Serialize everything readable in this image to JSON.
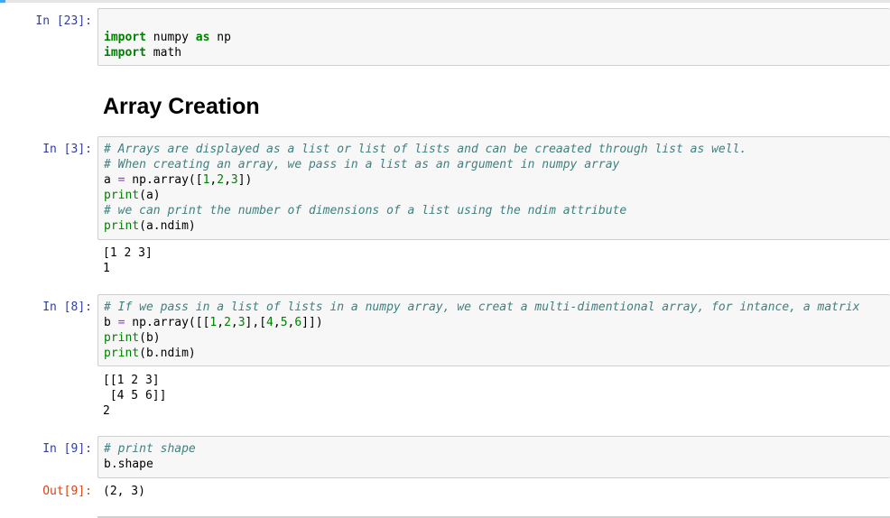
{
  "cells": [
    {
      "prompt": "In [23]:",
      "lines": [
        [
          {
            "t": "import",
            "c": "kw"
          },
          {
            "t": " numpy ",
            "c": ""
          },
          {
            "t": "as",
            "c": "kw"
          },
          {
            "t": " np",
            "c": ""
          }
        ],
        [
          {
            "t": "import",
            "c": "kw"
          },
          {
            "t": " math",
            "c": ""
          }
        ]
      ]
    },
    {
      "markdown_heading": "Array Creation"
    },
    {
      "prompt": "In [3]:",
      "lines": [
        [
          {
            "t": "# Arrays are displayed as a list or list of lists and can be creaated through list as well.",
            "c": "cm"
          }
        ],
        [
          {
            "t": "# When creating an array, we pass in a list as an argument in numpy array",
            "c": "cm"
          }
        ],
        [
          {
            "t": "a ",
            "c": ""
          },
          {
            "t": "=",
            "c": "op"
          },
          {
            "t": " np.array([",
            "c": ""
          },
          {
            "t": "1",
            "c": "nm"
          },
          {
            "t": ",",
            "c": ""
          },
          {
            "t": "2",
            "c": "nm"
          },
          {
            "t": ",",
            "c": ""
          },
          {
            "t": "3",
            "c": "nm"
          },
          {
            "t": "])",
            "c": ""
          }
        ],
        [
          {
            "t": "print",
            "c": "bi"
          },
          {
            "t": "(a)",
            "c": ""
          }
        ],
        [
          {
            "t": "# we can print the number of dimensions of a list using the ndim attribute",
            "c": "cm"
          }
        ],
        [
          {
            "t": "print",
            "c": "bi"
          },
          {
            "t": "(a.ndim)",
            "c": ""
          }
        ]
      ],
      "output": [
        "[1 2 3]",
        "1"
      ]
    },
    {
      "prompt": "In [8]:",
      "lines": [
        [
          {
            "t": "# If we pass in a list of lists in a numpy array, we creat a multi-dimentional array, for intance, a matrix",
            "c": "cm"
          }
        ],
        [
          {
            "t": "b ",
            "c": ""
          },
          {
            "t": "=",
            "c": "op"
          },
          {
            "t": " np.array([[",
            "c": ""
          },
          {
            "t": "1",
            "c": "nm"
          },
          {
            "t": ",",
            "c": ""
          },
          {
            "t": "2",
            "c": "nm"
          },
          {
            "t": ",",
            "c": ""
          },
          {
            "t": "3",
            "c": "nm"
          },
          {
            "t": "],[",
            "c": ""
          },
          {
            "t": "4",
            "c": "nm"
          },
          {
            "t": ",",
            "c": ""
          },
          {
            "t": "5",
            "c": "nm"
          },
          {
            "t": ",",
            "c": ""
          },
          {
            "t": "6",
            "c": "nm"
          },
          {
            "t": "]])",
            "c": ""
          }
        ],
        [
          {
            "t": "print",
            "c": "bi"
          },
          {
            "t": "(b)",
            "c": ""
          }
        ],
        [
          {
            "t": "print",
            "c": "bi"
          },
          {
            "t": "(b.ndim)",
            "c": ""
          }
        ]
      ],
      "output": [
        "[[1 2 3]",
        " [4 5 6]]",
        "2"
      ]
    },
    {
      "prompt": "In [9]:",
      "lines": [
        [
          {
            "t": "# print shape",
            "c": "cm"
          }
        ],
        [
          {
            "t": "b.shape",
            "c": ""
          }
        ]
      ],
      "out_prompt": "Out[9]:",
      "output": [
        "(2, 3)"
      ]
    }
  ]
}
